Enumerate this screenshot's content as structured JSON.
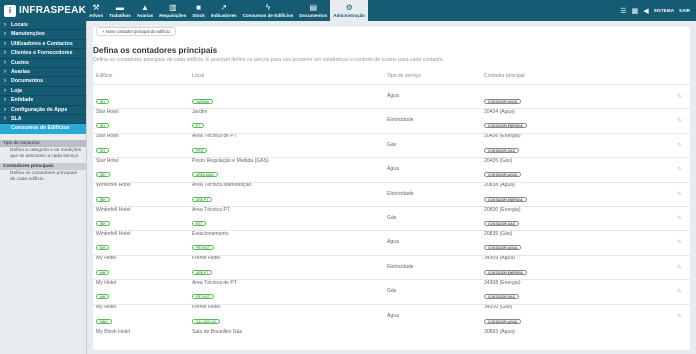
{
  "app": {
    "logo_letter": "i",
    "logo_text": "INFRASPEAK"
  },
  "nav": [
    {
      "label": "Ativos",
      "icon": "wrench-icon",
      "glyph": "⚒"
    },
    {
      "label": "Trabalhos",
      "icon": "briefcase-icon",
      "glyph": "▬"
    },
    {
      "label": "Avarias",
      "icon": "warning-icon",
      "glyph": "▲"
    },
    {
      "label": "Requisições",
      "icon": "cart-icon",
      "glyph": "▥"
    },
    {
      "label": "Stock",
      "icon": "box-icon",
      "glyph": "■"
    },
    {
      "label": "Indicadores",
      "icon": "chart-icon",
      "glyph": "↗"
    },
    {
      "label": "Consumos de Edifícios",
      "icon": "bolt-icon",
      "glyph": "ϟ"
    },
    {
      "label": "Documentos",
      "icon": "document-icon",
      "glyph": "▤"
    },
    {
      "label": "Administração",
      "icon": "gears-icon",
      "glyph": "⚙"
    }
  ],
  "topright": {
    "list_icon": "☰",
    "calendar_icon": "▦",
    "megaphone_icon": "◀",
    "user_label": "SISTEMA",
    "logout_label": "SAIR"
  },
  "sidebar": {
    "items": [
      "Locais",
      "Manutenções",
      "Utilizadores e Contactos",
      "Clientes e Fornecedores",
      "Custos",
      "Avarias",
      "Documentos",
      "Loja",
      "Entidade",
      "Configuração de Apps",
      "SLA",
      "Consumos de Edifícios"
    ],
    "subs": [
      {
        "title": "Tipo de consumo",
        "desc": "Defina a categoria e as medições que se associam a cada serviço"
      },
      {
        "title": "Contadores principais",
        "desc": "Defina os contadores principais de cada edifício"
      }
    ]
  },
  "content": {
    "new_button": "+ Novo contador principal do edifício",
    "title": "Defina os contadores principais",
    "subtitle": "Defina os contadores principais de cada edifício. É possível definir os preços para uso posterior em estatísticas e controlo de custos para cada contador.",
    "headers": {
      "building": "Edifício",
      "place": "Local",
      "service": "Tipo de serviço",
      "meter": "Contador principal"
    },
    "rows": [
      {
        "b_badge": "SH",
        "building": "Star Hotel",
        "p_badge": "JARDIM",
        "place": "Jardim",
        "service": "Água",
        "m_badge": "CONTADOR.AGUA",
        "meter": "20434 (Água)"
      },
      {
        "b_badge": "SH",
        "building": "Star Hotel",
        "p_badge": "PT",
        "place": "Área Técnica de PT",
        "service": "Eletricidade",
        "m_badge": "CONTADOR.ENERGIA",
        "meter": "20436 (Energia)"
      },
      {
        "b_badge": "SH",
        "building": "Star Hotel",
        "p_badge": "PRG",
        "place": "Posto Regulação e Medida (GÁS)",
        "service": "Gás",
        "m_badge": "CONTADOR.GAS",
        "meter": "20435 (Gás)"
      },
      {
        "b_badge": "WH",
        "building": "Winterfell Hotel",
        "p_badge": "AREA.MAN",
        "place": "Área Técnica Manutenção",
        "service": "Água",
        "m_badge": "CONTADOR.AGUA",
        "meter": "20838 (Água)"
      },
      {
        "b_badge": "WH",
        "building": "Winterfell Hotel",
        "p_badge": "ARE.PT",
        "place": "Área Técnica PT",
        "service": "Eletricidade",
        "m_badge": "CONTADOR.ENERGIA",
        "meter": "20830 (Energia)"
      },
      {
        "b_badge": "WH",
        "building": "Winterfell Hotel",
        "p_badge": "EST",
        "place": "Estacionamento",
        "service": "Gás",
        "m_badge": "CONTADOR.GAS",
        "meter": "20835 (Gás)"
      },
      {
        "b_badge": "MH",
        "building": "My Hotel",
        "p_badge": "FRT.HOT",
        "place": "Frente Hotel",
        "service": "Água",
        "m_badge": "CONTADOR.AGUA",
        "meter": "34309 (Água)"
      },
      {
        "b_badge": "MH",
        "building": "My Hotel",
        "p_badge": "ARE.PT",
        "place": "Área Técnica de PT",
        "service": "Eletricidade",
        "m_badge": "CONTADOR.ENERGIA",
        "meter": "34308 (Energia)"
      },
      {
        "b_badge": "MH",
        "building": "My Hotel",
        "p_badge": "FRT.HOT",
        "place": "Frente Hotel",
        "service": "Gás",
        "m_badge": "CONTADOR.GAS",
        "meter": "34310 (Gás)"
      },
      {
        "b_badge": "MBH",
        "building": "My Block Hotel",
        "p_badge": "SAL.BOILAS",
        "place": "Sala de Boueilles Gás",
        "service": "Água",
        "m_badge": "CONTADOR.AGUA",
        "meter": "30893 (Água)"
      }
    ],
    "edit_icon": "✎"
  },
  "colors": {
    "brand": "#155b73",
    "accent": "#2aa9d4",
    "badge_green": "#5cb85c"
  }
}
